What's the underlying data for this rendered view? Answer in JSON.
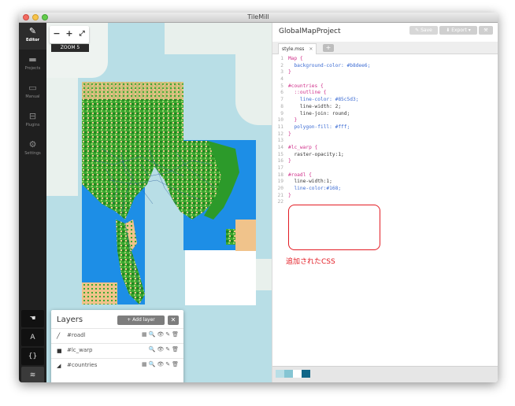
{
  "window": {
    "title": "TileMill"
  },
  "sidebar": {
    "items": [
      {
        "label": "Editor",
        "icon": "pencil-icon",
        "active": true
      },
      {
        "label": "Projects",
        "icon": "folder-icon",
        "active": false
      },
      {
        "label": "Manual",
        "icon": "book-icon",
        "active": false
      },
      {
        "label": "Plugins",
        "icon": "plugin-icon",
        "active": false
      },
      {
        "label": "Settings",
        "icon": "gear-icon",
        "active": false
      }
    ],
    "tools": [
      {
        "glyph": "☚",
        "name": "hand-tool-icon"
      },
      {
        "glyph": "A",
        "name": "font-tool-icon"
      },
      {
        "glyph": "{}",
        "name": "carto-tool-icon"
      },
      {
        "glyph": "≋",
        "name": "layers-tool-icon"
      }
    ]
  },
  "map": {
    "zoom_label": "ZOOM 5",
    "zoom_out": "−",
    "zoom_in": "+",
    "fullscreen": "⤢"
  },
  "layers": {
    "title": "Layers",
    "add_label": "+ Add layer",
    "close": "✕",
    "rows": [
      {
        "icon": "line-icon",
        "glyph": "╱",
        "name": "#roadl",
        "actions": "▦🔍👁✎🗑"
      },
      {
        "icon": "raster-icon",
        "glyph": "■",
        "name": "#lc_warp",
        "actions": "🔍👁✎🗑"
      },
      {
        "icon": "polygon-icon",
        "glyph": "◢",
        "name": "#countries",
        "actions": "▦🔍👁✎🗑"
      }
    ]
  },
  "editor": {
    "project_title": "GlobalMapProject",
    "save_label": "Save",
    "export_label": "Export",
    "tab_label": "style.mss",
    "tab_close": "✕",
    "tab_add": "+",
    "code": [
      {
        "n": "1",
        "t": "Map {"
      },
      {
        "n": "2",
        "t": "  background-color: #b8dee6;"
      },
      {
        "n": "3",
        "t": "}"
      },
      {
        "n": "4",
        "t": ""
      },
      {
        "n": "5",
        "t": "#countries {"
      },
      {
        "n": "6",
        "t": "  ::outline {"
      },
      {
        "n": "7",
        "t": "    line-color: #85c5d3;"
      },
      {
        "n": "8",
        "t": "    line-width: 2;"
      },
      {
        "n": "9",
        "t": "    line-join: round;"
      },
      {
        "n": "10",
        "t": "  }"
      },
      {
        "n": "11",
        "t": "  polygon-fill: #fff;"
      },
      {
        "n": "12",
        "t": "}"
      },
      {
        "n": "13",
        "t": ""
      },
      {
        "n": "14",
        "t": "#lc_warp {"
      },
      {
        "n": "15",
        "t": "  raster-opacity:1;"
      },
      {
        "n": "16",
        "t": "}"
      },
      {
        "n": "17",
        "t": ""
      },
      {
        "n": "18",
        "t": "#roadl {"
      },
      {
        "n": "19",
        "t": "  line-width:1;"
      },
      {
        "n": "20",
        "t": "  line-color:#168;"
      },
      {
        "n": "21",
        "t": "}"
      },
      {
        "n": "22",
        "t": ""
      }
    ],
    "annotation": "追加されたCSS"
  },
  "colors": {
    "map_background": "#b8dee6",
    "outline": "#85c5d3",
    "road": "#168",
    "annotation": "#e31b23",
    "swatches": [
      "#b8dee6",
      "#85c5d3",
      "#ffffff",
      "#116688"
    ]
  }
}
